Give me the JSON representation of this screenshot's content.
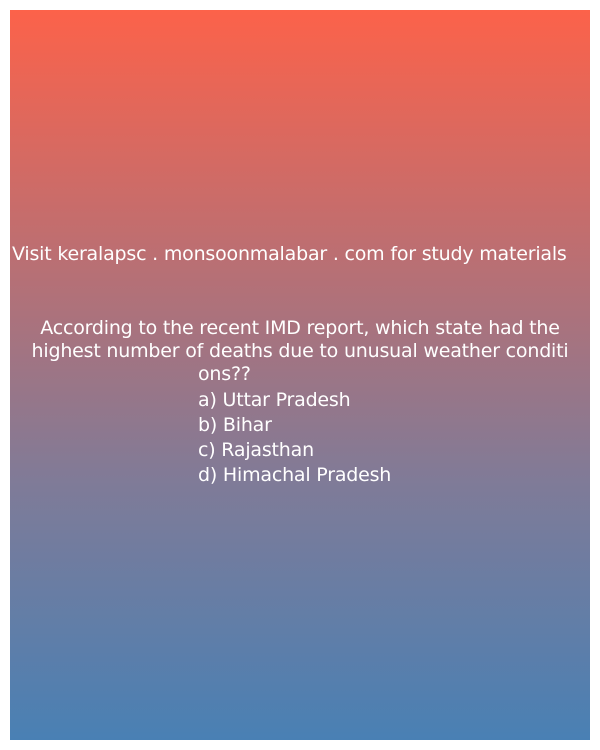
{
  "promo_text": "Visit keralapsc . monsoonmalabar . com for study materials",
  "question": {
    "line1": "According to the recent IMD report, which state had the",
    "line2": "highest number of deaths due to unusual weather conditi",
    "line3": "ons??"
  },
  "options": [
    "a) Uttar Pradesh",
    "b) Bihar",
    "c) Rajasthan",
    "d) Himachal Pradesh"
  ],
  "colors": {
    "gradient_top": "#fc624a",
    "gradient_bottom": "#4980b4",
    "text": "#ffffff"
  }
}
